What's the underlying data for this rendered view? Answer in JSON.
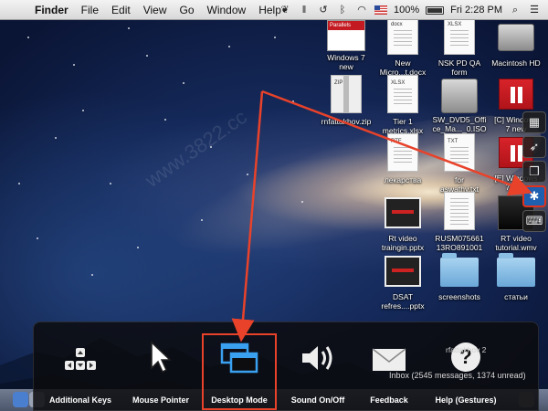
{
  "menubar": {
    "app_name": "Finder",
    "menus": [
      "File",
      "Edit",
      "View",
      "Go",
      "Window",
      "Help"
    ],
    "battery": "100%",
    "clock": "Fri 2:28 PM"
  },
  "desktop_icons": [
    {
      "label": "Windows 7\nnew",
      "kind": "parallels-doc"
    },
    {
      "label": "New\nMicro...t.docx",
      "kind": "docx"
    },
    {
      "label": "NSK PD QA\nform",
      "kind": "xlsx"
    },
    {
      "label": "Macintosh HD",
      "kind": "hd"
    },
    {
      "label": "rnfattakhov.zip",
      "kind": "zip"
    },
    {
      "label": "Tier 1\nmetrics.xlsx",
      "kind": "xlsx"
    },
    {
      "label": "SW_DVD5_Offi\nce_Ma..._0.ISO",
      "kind": "iso"
    },
    {
      "label": "[C] Windows\n7 new",
      "kind": "parallels"
    },
    {
      "label": "лекарства",
      "kind": "rtf"
    },
    {
      "label": "for\naswathy.txt",
      "kind": "txt"
    },
    {
      "label": "[E] Windows\n7 new",
      "kind": "parallels"
    },
    {
      "label": "Rt video\ntraingin.pptx",
      "kind": "pptx"
    },
    {
      "label": "RUSM075661\n13RO891001",
      "kind": "doc"
    },
    {
      "label": "RT video\ntutorial.wmv",
      "kind": "black"
    },
    {
      "label": "DSAT\nrefres....pptx",
      "kind": "pptx"
    },
    {
      "label": "screenshots",
      "kind": "folder"
    },
    {
      "label": "статьи",
      "kind": "folder"
    },
    {
      "label": "rfattakhov 2",
      "kind": "folder-partial"
    }
  ],
  "icon_tags": {
    "docx": "docx",
    "xlsx": "XLSX",
    "zip": "ZIP",
    "rtf": "RTF",
    "txt": "TXT",
    "parallels": "Parallels"
  },
  "feature_panel": {
    "items": [
      {
        "label": "Additional Keys",
        "icon": "keys-icon"
      },
      {
        "label": "Mouse Pointer",
        "icon": "pointer-icon"
      },
      {
        "label": "Desktop Mode",
        "icon": "desktop-mode-icon"
      },
      {
        "label": "Sound On/Off",
        "icon": "speaker-icon"
      },
      {
        "label": "Feedback",
        "icon": "envelope-icon"
      },
      {
        "label": "Help (Gestures)",
        "icon": "help-icon"
      }
    ],
    "inbox_status": "Inbox (2545 messages, 1374 unread)"
  },
  "side_toolbar": [
    "windows-icon",
    "rocket-icon",
    "gear-icon",
    "keyboard-icon"
  ],
  "colors": {
    "highlight": "#e8422a",
    "gear_active": "#1e5fb0"
  },
  "watermark": "www.3822.cc"
}
